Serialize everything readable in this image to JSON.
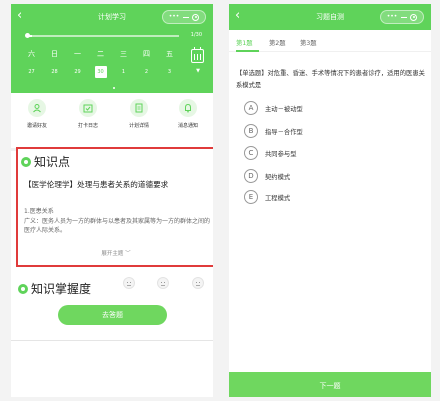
{
  "left": {
    "title": "计划学习",
    "progress": {
      "text": "1/30",
      "value": 0.0333
    },
    "weekdays": [
      "六",
      "日",
      "一",
      "二",
      "三",
      "四",
      "五"
    ],
    "dates": [
      "27",
      "28",
      "29",
      "30",
      "1",
      "2",
      "3"
    ],
    "today_index": 3,
    "calendar_arrow": "▼",
    "shortcuts": [
      {
        "label": "邀请好友",
        "icon": "user-icon"
      },
      {
        "label": "打卡日志",
        "icon": "calendar-check-icon"
      },
      {
        "label": "计划详情",
        "icon": "document-icon"
      },
      {
        "label": "消息通知",
        "icon": "bell-icon"
      }
    ],
    "knowledge": {
      "heading": "知识点",
      "title": "【医学伦理学】处理与患者关系的道德要求",
      "subtitle": "1.医患关系",
      "definition": "广义：医务人员为一方的群体与以患者及其家属等为一方的群体之间的医疗人际关系。",
      "expand": "展开主题"
    },
    "mastery": {
      "heading": "知识掌握度",
      "faces": [
        "neutral-face-icon",
        "neutral-face-icon",
        "neutral-face-icon"
      ]
    },
    "answer_button": "去答题"
  },
  "right": {
    "title": "习题自测",
    "tabs": [
      "第1题",
      "第2题",
      "第3题"
    ],
    "active_tab": 0,
    "question": "【单选题】对危重、昏迷、手术等情况下的患者诊疗，适用的医患关系模式是",
    "options": [
      {
        "key": "A",
        "text": "主动－被动型"
      },
      {
        "key": "B",
        "text": "指导－合作型"
      },
      {
        "key": "C",
        "text": "共同参与型"
      },
      {
        "key": "D",
        "text": "契约模式"
      },
      {
        "key": "E",
        "text": "工程模式"
      }
    ],
    "next_button": "下一题"
  },
  "colors": {
    "accent": "#5fd35a",
    "highlight_border": "#e03b3b"
  },
  "capsule": {
    "menu_icon": "more-dots-icon",
    "minimize_icon": "minus-icon",
    "close_icon": "target-icon"
  }
}
